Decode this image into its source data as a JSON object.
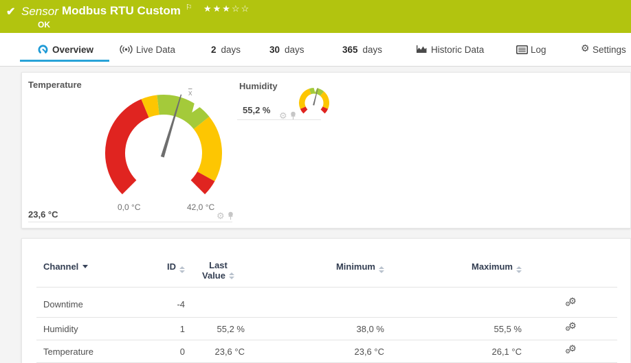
{
  "header": {
    "object_type": "Sensor",
    "title": "Modbus RTU Custom",
    "status": "OK",
    "check_icon": "✔",
    "flag_icon": "⚐",
    "stars_filled": "★★★",
    "stars_empty": "☆☆",
    "rating": "3 of 5",
    "status_color": "#b2c40f"
  },
  "tabs": {
    "overview": {
      "label": "Overview",
      "active": true
    },
    "live_data": {
      "label": "Live Data"
    },
    "days2": {
      "number": "2",
      "label": "days"
    },
    "days30": {
      "number": "30",
      "label": "days"
    },
    "days365": {
      "number": "365",
      "label": "days"
    },
    "historic": {
      "label": "Historic Data"
    },
    "log": {
      "label": "Log"
    },
    "settings": {
      "label": "Settings",
      "gear_glyph": "⚙"
    }
  },
  "colors": {
    "accent_blue": "#29a3d8",
    "gauge_red": "#e02420",
    "gauge_yellow": "#fdc602",
    "gauge_green": "#a4ca3a",
    "needle_gray": "#6e6e6e"
  },
  "gauges": {
    "temperature": {
      "title": "Temperature",
      "value": "23,6 °C",
      "scale_min_label": "0,0 °C",
      "scale_max_label": "42,0 °C",
      "range": [
        0,
        42
      ],
      "needle_value": 23.6,
      "average_marker": "x",
      "segments": [
        {
          "from": 0,
          "to": 17.5,
          "color": "#e02420"
        },
        {
          "from": 17.5,
          "to": 20,
          "color": "#fdc602"
        },
        {
          "from": 20,
          "to": 29,
          "color": "#a4ca3a"
        },
        {
          "from": 29,
          "to": 39.5,
          "color": "#fdc602"
        },
        {
          "from": 39.5,
          "to": 42,
          "color": "#e02420"
        }
      ],
      "gear_glyph": "⚙"
    },
    "humidity": {
      "title": "Humidity",
      "value": "55,2 %",
      "range": [
        0,
        100
      ],
      "needle_value": 55.2,
      "segments": [
        {
          "from": 0,
          "to": 8,
          "color": "#e02420"
        },
        {
          "from": 8,
          "to": 43,
          "color": "#fdc602"
        },
        {
          "from": 43,
          "to": 65,
          "color": "#a4ca3a"
        },
        {
          "from": 65,
          "to": 92,
          "color": "#fdc602"
        },
        {
          "from": 92,
          "to": 100,
          "color": "#e02420"
        }
      ],
      "gear_glyph": "⚙"
    }
  },
  "table": {
    "columns": {
      "channel": "Channel",
      "id": "ID",
      "last_line1": "Last",
      "last_line2": "Value",
      "minimum": "Minimum",
      "maximum": "Maximum"
    },
    "rows": [
      {
        "channel": "Downtime",
        "id": "-4",
        "last": "",
        "min": "",
        "max": ""
      },
      {
        "channel": "Humidity",
        "id": "1",
        "last": "55,2 %",
        "min": "38,0 %",
        "max": "55,5 %"
      },
      {
        "channel": "Temperature",
        "id": "0",
        "last": "23,6 °C",
        "min": "23,6 °C",
        "max": "26,1 °C"
      }
    ],
    "gear_glyph": "⚙"
  }
}
